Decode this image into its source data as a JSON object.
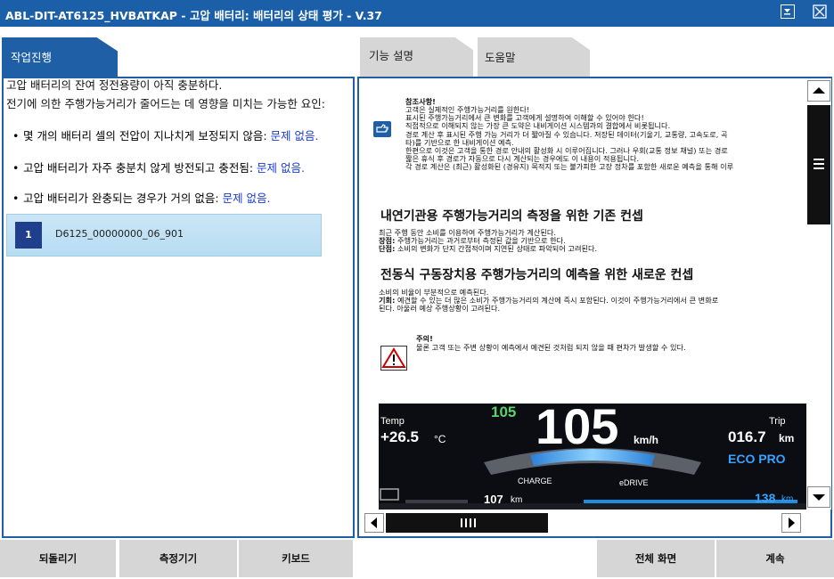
{
  "window": {
    "title": "ABL-DIT-AT6125_HVBATKAP - 고압 배터리: 배터리의 상태 평가 - V.37",
    "accent_color": "#1f5fa6",
    "min_icon": "minimize-icon",
    "close_icon": "close-icon"
  },
  "tabs": {
    "progress": "작업진행",
    "function": "기능 설명",
    "help": "도움말"
  },
  "left": {
    "line1": "고압 배터리의 잔여 정전용량이 아직 충분하다.",
    "line2": "전기에 의한 주행가능거리가 줄어드는 데 영향을 미치는 가능한 요인:",
    "bullets": [
      {
        "text": "몇 개의 배터리 셀의 전압이 지나치게 보정되지 않음: ",
        "status": "문제 없음."
      },
      {
        "text": "고압 배터리가 자주 충분치 않게 방전되고 충전됨: ",
        "status": "문제 없음."
      },
      {
        "text": "고압 배터리가 완충되는 경우가 거의 없음: ",
        "status": "문제 없음."
      }
    ],
    "result": {
      "number": "1",
      "code": "D6125_00000000_06_901"
    }
  },
  "doc": {
    "note_title": "참조사항!",
    "note_lines": [
      "고객은 실제적인 주행가능거리를 원한다!",
      "표시된 주행가능거리에서 큰 변화를 고객에게 설명하여 이해할 수 있어야 한다!",
      "직접적으로 이해되지 않는 가장 큰 도약은 내비게이션 시스템과의 결합에서 비롯됩니다.",
      "경로 계산 후 표시된 주행 가능 거리가 더 짧아질 수 있습니다. 저장된 데이터(기울기, 교통량, 고속도로, 곡",
      "타)를 기반으로 한 내비게이션 예측.",
      "한편으로 이것은 고객을 통한 경로 안내의 활성화 시 이루어집니다. 그러나 우회(교통 정보 채널) 또는 경로",
      "짧은 휴식 후 경로가 자동으로 다시 계산되는 경우에도 이 내용이 적용됩니다.",
      "각 경로 계산은 (최근) 활성화된 (경유지) 목적지 또는 불가피한 고장 정차를 포함한 새로운 예측을 통해 이루"
    ],
    "h1": "내연기관용 주행가능거리의 측정을 위한 기존 컨셉",
    "p1": [
      {
        "bold": "",
        "text": "최근 주행 동안 소비를 이용하여 주행가능거리가 계산된다."
      },
      {
        "bold": "장점:",
        "text": " 주행가능거리는 과거로부터 측정된 값을 기반으로 한다."
      },
      {
        "bold": "단점:",
        "text": " 소비의 변화가 단지 간접적이며 지연된 상태로 파악되어 고려된다."
      }
    ],
    "h2": "전동식 구동장치용 주행가능거리의 예측을 위한 새로운 컨셉",
    "p2": [
      {
        "bold": "",
        "text": "소비의 비율이 부분적으로 예측된다."
      },
      {
        "bold": "기회:",
        "text": " 예견할 수 있는 더 많은 소비가 주행가능거리의 계산에 즉시 포함된다. 이것이 주행가능거리에서 큰 변화로"
      },
      {
        "bold": "",
        "text": "된다. 아울러 예상 주행상황이 고려된다."
      }
    ],
    "warn_title": "주의!",
    "warn_text": "물론 고객 또는 주변 상황이 예측에서 예견된 것처럼 되지 않을 때 편차가 발생할 수 있다."
  },
  "dashboard": {
    "temp_label": "Temp",
    "temp_value": "+26.5",
    "temp_unit": "°C",
    "limit": "105",
    "speed": "105",
    "speed_unit": "km/h",
    "trip_label": "Trip",
    "trip_value": "016.7",
    "trip_unit": "km",
    "mode": "ECO PRO",
    "charge_label": "CHARGE",
    "edrive_label": "eDRIVE",
    "range_left": "107",
    "range_left_unit": "km",
    "range_right": "138",
    "range_right_unit": "km"
  },
  "bottom": {
    "back": "되돌리기",
    "measure": "측정기기",
    "keyboard": "키보드",
    "fullscreen": "전체 화면",
    "next": "계속"
  }
}
